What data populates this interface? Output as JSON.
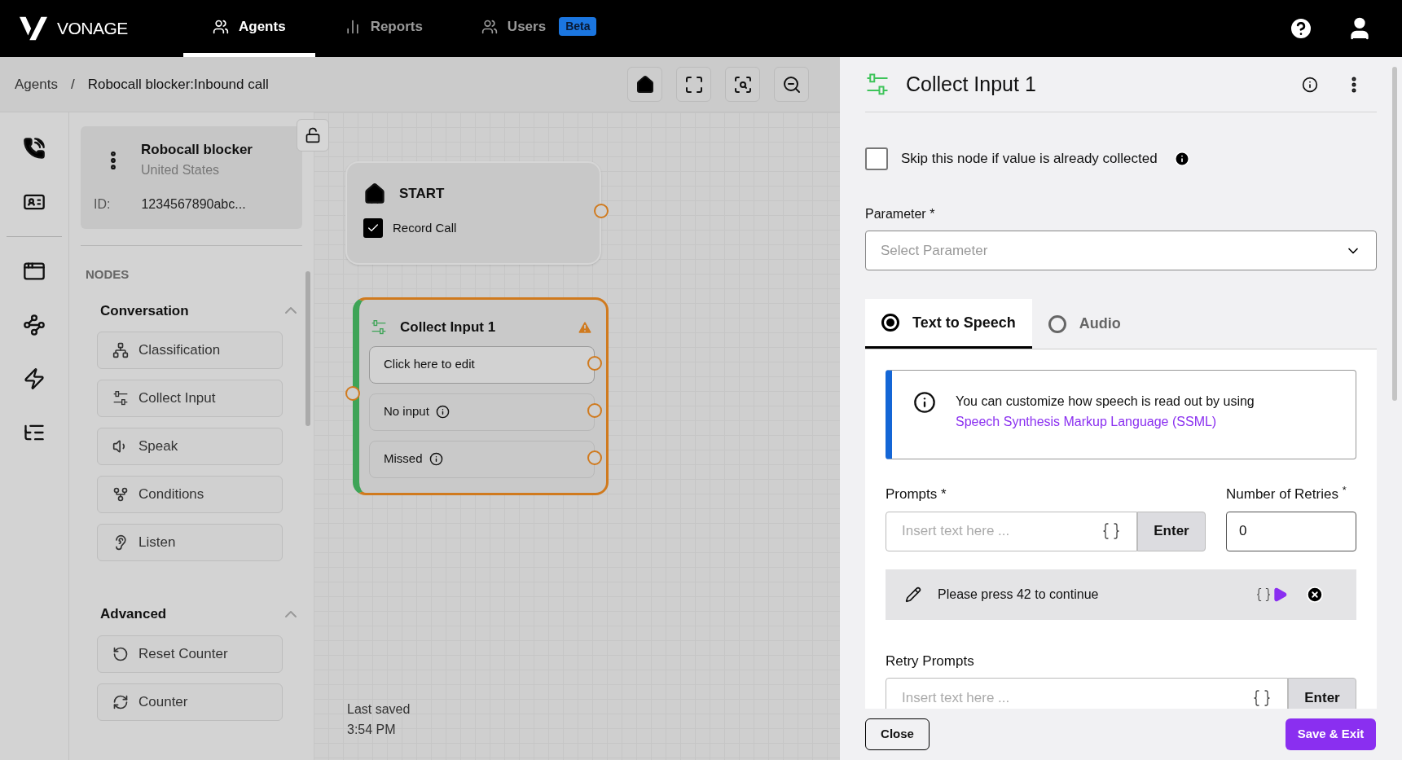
{
  "nav": {
    "brand": "VONAGE",
    "tabs": [
      {
        "label": "Agents",
        "selected": true
      },
      {
        "label": "Reports",
        "selected": false
      },
      {
        "label": "Users",
        "selected": false,
        "badge": "Beta"
      }
    ]
  },
  "breadcrumb": {
    "parent": "Agents",
    "separator": "/",
    "current": "Robocall blocker:Inbound call"
  },
  "agent_card": {
    "name": "Robocall blocker",
    "country": "United States",
    "id_label": "ID:",
    "id": "1234567890abc..."
  },
  "nodes_heading": "NODES",
  "groups": [
    {
      "title": "Conversation",
      "expanded": true,
      "items": [
        "Classification",
        "Collect Input",
        "Speak",
        "Conditions",
        "Listen"
      ]
    },
    {
      "title": "Advanced",
      "expanded": true,
      "items": [
        "Reset Counter",
        "Counter"
      ]
    }
  ],
  "start_node": {
    "title": "START",
    "record_call": {
      "label": "Record Call",
      "checked": true
    }
  },
  "collect_node": {
    "title": "Collect Input 1",
    "warning": true,
    "outputs": [
      {
        "label": "Click here to edit",
        "info": false,
        "selected": true
      },
      {
        "label": "No input",
        "info": true,
        "selected": false
      },
      {
        "label": "Missed",
        "info": true,
        "selected": false
      }
    ]
  },
  "last_saved": {
    "label": "Last saved",
    "time": "3:54 PM"
  },
  "panel": {
    "title": "Collect Input 1",
    "skip": {
      "label": "Skip this node if value is already collected",
      "checked": false
    },
    "parameter": {
      "label": "Parameter *",
      "placeholder": "Select Parameter"
    },
    "tabs": [
      {
        "label": "Text to Speech",
        "selected": true
      },
      {
        "label": "Audio",
        "selected": false
      }
    ],
    "info": {
      "text": "You can customize how speech is read out by using",
      "link": "Speech Synthesis Markup Language (SSML)"
    },
    "prompts": {
      "label": "Prompts *",
      "placeholder": "Insert text here ...",
      "button": "Enter"
    },
    "retries": {
      "label": "Number of Retries $^{*}$",
      "value": "0"
    },
    "prompt_items": [
      {
        "text": "Please press 42 to continue"
      }
    ],
    "retry_prompts": {
      "label": "Retry Prompts",
      "placeholder": "Insert text here ...",
      "button": "Enter"
    },
    "buttons": {
      "close": "Close",
      "save": "Save & Exit"
    }
  }
}
